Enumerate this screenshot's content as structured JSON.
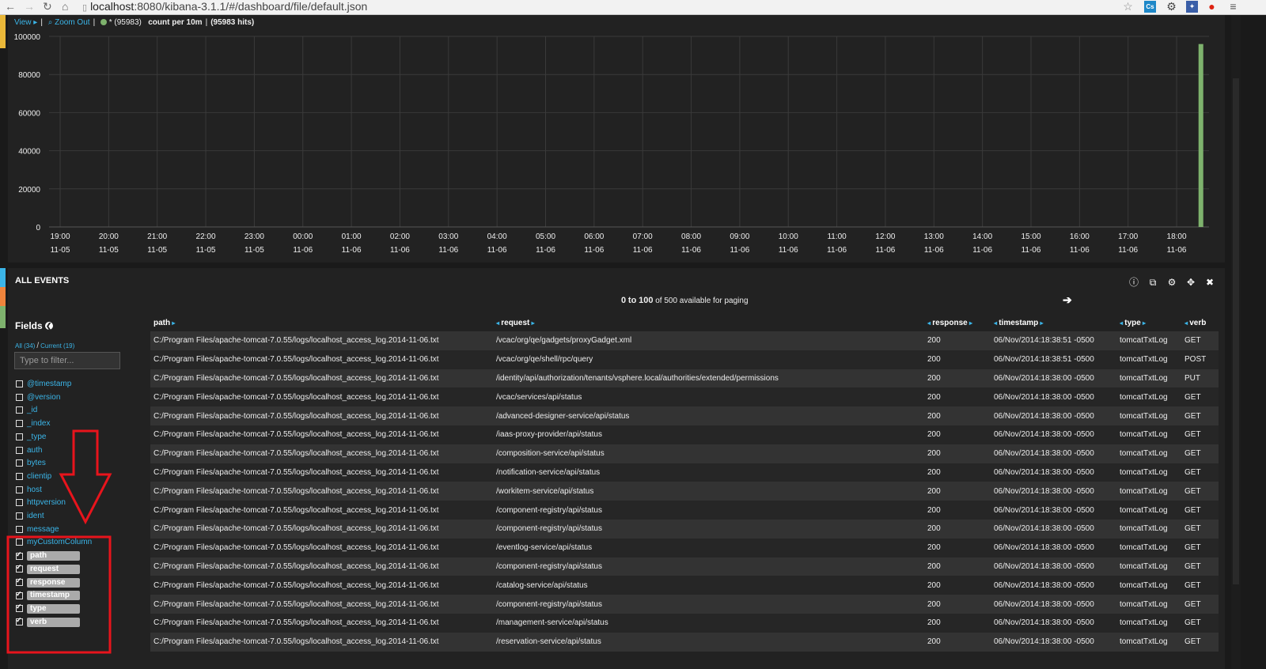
{
  "browser": {
    "url_host": "localhost",
    "url_rest": ":8080/kibana-3.1.1/#/dashboard/file/default.json",
    "ext_cast": "Cs"
  },
  "histogram": {
    "view_label": "View",
    "zoom_label": "Zoom Out",
    "series_label": "* (95983)",
    "interval_text": "count per 10m",
    "hits_text": "(95983 hits)",
    "colors": {
      "series": "#7eb26d",
      "link": "#3bb5e8"
    }
  },
  "chart_data": {
    "type": "bar",
    "ylim": [
      0,
      100000
    ],
    "y_ticks": [
      "0",
      "20000",
      "40000",
      "60000",
      "80000",
      "100000"
    ],
    "y_tick_values": [
      0,
      20000,
      40000,
      60000,
      80000,
      100000
    ],
    "x_ticks": [
      {
        "time": "19:00",
        "date": "11-05"
      },
      {
        "time": "20:00",
        "date": "11-05"
      },
      {
        "time": "21:00",
        "date": "11-05"
      },
      {
        "time": "22:00",
        "date": "11-05"
      },
      {
        "time": "23:00",
        "date": "11-05"
      },
      {
        "time": "00:00",
        "date": "11-06"
      },
      {
        "time": "01:00",
        "date": "11-06"
      },
      {
        "time": "02:00",
        "date": "11-06"
      },
      {
        "time": "03:00",
        "date": "11-06"
      },
      {
        "time": "04:00",
        "date": "11-06"
      },
      {
        "time": "05:00",
        "date": "11-06"
      },
      {
        "time": "06:00",
        "date": "11-06"
      },
      {
        "time": "07:00",
        "date": "11-06"
      },
      {
        "time": "08:00",
        "date": "11-06"
      },
      {
        "time": "09:00",
        "date": "11-06"
      },
      {
        "time": "10:00",
        "date": "11-06"
      },
      {
        "time": "11:00",
        "date": "11-06"
      },
      {
        "time": "12:00",
        "date": "11-06"
      },
      {
        "time": "13:00",
        "date": "11-06"
      },
      {
        "time": "14:00",
        "date": "11-06"
      },
      {
        "time": "15:00",
        "date": "11-06"
      },
      {
        "time": "16:00",
        "date": "11-06"
      },
      {
        "time": "17:00",
        "date": "11-06"
      },
      {
        "time": "18:00",
        "date": "11-06"
      }
    ],
    "bars": [
      {
        "time": "11-06 18:30",
        "value": 95983
      }
    ],
    "grid": true,
    "legend": "none"
  },
  "events": {
    "title": "ALL EVENTS",
    "paging_from": "0",
    "paging_to_word": "to",
    "paging_to": "100",
    "paging_rest": "of 500 available for paging",
    "fields_title": "Fields",
    "fields_all": "All (34)",
    "fields_current": "Current (19)",
    "filter_placeholder": "Type to filter...",
    "fields": [
      {
        "name": "@timestamp",
        "checked": false
      },
      {
        "name": "@version",
        "checked": false
      },
      {
        "name": "_id",
        "checked": false
      },
      {
        "name": "_index",
        "checked": false
      },
      {
        "name": "_type",
        "checked": false
      },
      {
        "name": "auth",
        "checked": false
      },
      {
        "name": "bytes",
        "checked": false
      },
      {
        "name": "clientip",
        "checked": false
      },
      {
        "name": "host",
        "checked": false
      },
      {
        "name": "httpversion",
        "checked": false
      },
      {
        "name": "ident",
        "checked": false
      },
      {
        "name": "message",
        "checked": false
      },
      {
        "name": "myCustomColumn",
        "checked": false
      },
      {
        "name": "path",
        "checked": true
      },
      {
        "name": "request",
        "checked": true
      },
      {
        "name": "response",
        "checked": true
      },
      {
        "name": "timestamp",
        "checked": true
      },
      {
        "name": "type",
        "checked": true
      },
      {
        "name": "verb",
        "checked": true
      }
    ],
    "columns": [
      "path",
      "request",
      "response",
      "timestamp",
      "type",
      "verb"
    ],
    "rows": [
      [
        "C:/Program Files/apache-tomcat-7.0.55/logs/localhost_access_log.2014-11-06.txt",
        "/vcac/org/qe/gadgets/proxyGadget.xml",
        "200",
        "06/Nov/2014:18:38:51 -0500",
        "tomcatTxtLog",
        "GET"
      ],
      [
        "C:/Program Files/apache-tomcat-7.0.55/logs/localhost_access_log.2014-11-06.txt",
        "/vcac/org/qe/shell/rpc/query",
        "200",
        "06/Nov/2014:18:38:51 -0500",
        "tomcatTxtLog",
        "POST"
      ],
      [
        "C:/Program Files/apache-tomcat-7.0.55/logs/localhost_access_log.2014-11-06.txt",
        "/identity/api/authorization/tenants/vsphere.local/authorities/extended/permissions",
        "200",
        "06/Nov/2014:18:38:00 -0500",
        "tomcatTxtLog",
        "PUT"
      ],
      [
        "C:/Program Files/apache-tomcat-7.0.55/logs/localhost_access_log.2014-11-06.txt",
        "/vcac/services/api/status",
        "200",
        "06/Nov/2014:18:38:00 -0500",
        "tomcatTxtLog",
        "GET"
      ],
      [
        "C:/Program Files/apache-tomcat-7.0.55/logs/localhost_access_log.2014-11-06.txt",
        "/advanced-designer-service/api/status",
        "200",
        "06/Nov/2014:18:38:00 -0500",
        "tomcatTxtLog",
        "GET"
      ],
      [
        "C:/Program Files/apache-tomcat-7.0.55/logs/localhost_access_log.2014-11-06.txt",
        "/iaas-proxy-provider/api/status",
        "200",
        "06/Nov/2014:18:38:00 -0500",
        "tomcatTxtLog",
        "GET"
      ],
      [
        "C:/Program Files/apache-tomcat-7.0.55/logs/localhost_access_log.2014-11-06.txt",
        "/composition-service/api/status",
        "200",
        "06/Nov/2014:18:38:00 -0500",
        "tomcatTxtLog",
        "GET"
      ],
      [
        "C:/Program Files/apache-tomcat-7.0.55/logs/localhost_access_log.2014-11-06.txt",
        "/notification-service/api/status",
        "200",
        "06/Nov/2014:18:38:00 -0500",
        "tomcatTxtLog",
        "GET"
      ],
      [
        "C:/Program Files/apache-tomcat-7.0.55/logs/localhost_access_log.2014-11-06.txt",
        "/workitem-service/api/status",
        "200",
        "06/Nov/2014:18:38:00 -0500",
        "tomcatTxtLog",
        "GET"
      ],
      [
        "C:/Program Files/apache-tomcat-7.0.55/logs/localhost_access_log.2014-11-06.txt",
        "/component-registry/api/status",
        "200",
        "06/Nov/2014:18:38:00 -0500",
        "tomcatTxtLog",
        "GET"
      ],
      [
        "C:/Program Files/apache-tomcat-7.0.55/logs/localhost_access_log.2014-11-06.txt",
        "/component-registry/api/status",
        "200",
        "06/Nov/2014:18:38:00 -0500",
        "tomcatTxtLog",
        "GET"
      ],
      [
        "C:/Program Files/apache-tomcat-7.0.55/logs/localhost_access_log.2014-11-06.txt",
        "/eventlog-service/api/status",
        "200",
        "06/Nov/2014:18:38:00 -0500",
        "tomcatTxtLog",
        "GET"
      ],
      [
        "C:/Program Files/apache-tomcat-7.0.55/logs/localhost_access_log.2014-11-06.txt",
        "/component-registry/api/status",
        "200",
        "06/Nov/2014:18:38:00 -0500",
        "tomcatTxtLog",
        "GET"
      ],
      [
        "C:/Program Files/apache-tomcat-7.0.55/logs/localhost_access_log.2014-11-06.txt",
        "/catalog-service/api/status",
        "200",
        "06/Nov/2014:18:38:00 -0500",
        "tomcatTxtLog",
        "GET"
      ],
      [
        "C:/Program Files/apache-tomcat-7.0.55/logs/localhost_access_log.2014-11-06.txt",
        "/component-registry/api/status",
        "200",
        "06/Nov/2014:18:38:00 -0500",
        "tomcatTxtLog",
        "GET"
      ],
      [
        "C:/Program Files/apache-tomcat-7.0.55/logs/localhost_access_log.2014-11-06.txt",
        "/management-service/api/status",
        "200",
        "06/Nov/2014:18:38:00 -0500",
        "tomcatTxtLog",
        "GET"
      ],
      [
        "C:/Program Files/apache-tomcat-7.0.55/logs/localhost_access_log.2014-11-06.txt",
        "/reservation-service/api/status",
        "200",
        "06/Nov/2014:18:38:00 -0500",
        "tomcatTxtLog",
        "GET"
      ]
    ]
  },
  "theme": {
    "annotation": "#e8141c",
    "accent": "#3bb5e8"
  }
}
